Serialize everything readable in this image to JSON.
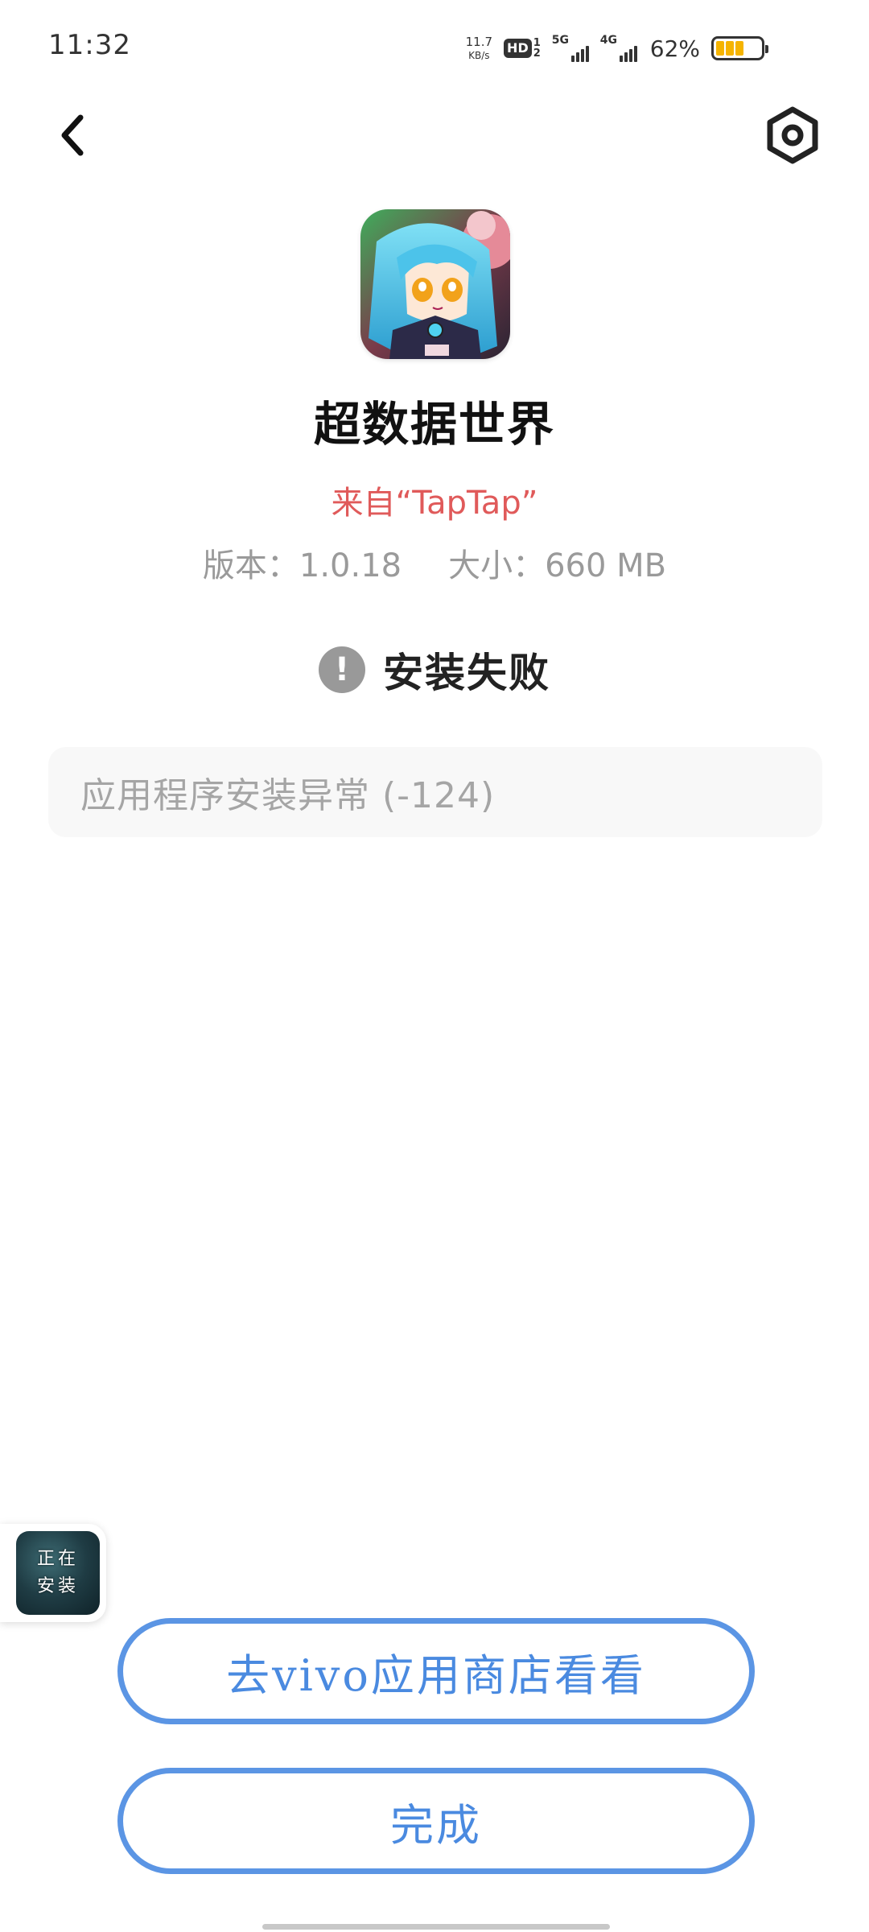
{
  "status_bar": {
    "time": "11:32",
    "net_speed_value": "11.7",
    "net_speed_unit": "KB/s",
    "hd_label": "HD",
    "hd_sub_top": "1",
    "hd_sub_bottom": "2",
    "sim1_label": "5G",
    "sim2_label": "4G",
    "battery_percent": "62%",
    "battery_level": 0.62,
    "battery_color": "#f5b400"
  },
  "nav": {
    "back_icon": "chevron-left-icon",
    "settings_icon": "hexagon-settings-icon"
  },
  "app": {
    "name": "超数据世界",
    "source": "来自“TapTap”",
    "version": "版本：1.0.18",
    "size": "大小：660 MB"
  },
  "status": {
    "fail_icon_glyph": "!",
    "fail_text": "安装失败",
    "error_message": "应用程序安装异常 (-124)"
  },
  "installing_widget": {
    "line1": "正在",
    "line2": "安装"
  },
  "buttons": {
    "store_label": "去vivo应用商店看看",
    "done_label": "完成"
  },
  "colors": {
    "accent": "#5b95e4",
    "source_red": "#e05a5a",
    "muted_gray": "#9a9a9a"
  }
}
